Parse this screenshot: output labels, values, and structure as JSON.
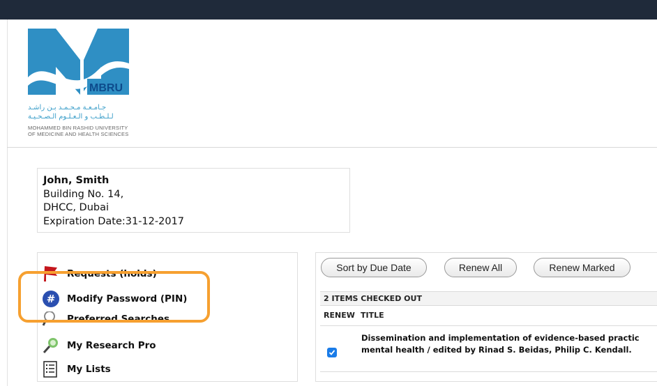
{
  "brand": {
    "logo_text": "MBRU",
    "arabic_line1": "جـامـعـة مـحـمـد بـن راشـد",
    "arabic_line2": "لـلـطـب و الـعـلـوم الـصـحـيـة",
    "english_line1": "MOHAMMED BIN RASHID UNIVERSITY",
    "english_line2": "OF MEDICINE AND HEALTH SCIENCES",
    "colors": {
      "primary_blue": "#2f8fc4",
      "dark_blue": "#0d4b8c",
      "highlight": "#f6a030"
    }
  },
  "patron": {
    "name": "John, Smith",
    "address1": "Building No. 14,",
    "address2": "DHCC, Dubai",
    "expiration": "Expiration Date:31-12-2017"
  },
  "menu": {
    "items": [
      {
        "label": "Requests (holds)",
        "icon": "flag-icon"
      },
      {
        "label": "Modify Password (PIN)",
        "icon": "hash-icon"
      },
      {
        "label": "Preferred Searches",
        "icon": "magnifier-icon"
      },
      {
        "label": "My Research Pro",
        "icon": "research-icon"
      },
      {
        "label": "My Lists",
        "icon": "list-icon"
      }
    ]
  },
  "checkout": {
    "buttons": {
      "sort": "Sort by Due Date",
      "renew_all": "Renew All",
      "renew_marked": "Renew Marked"
    },
    "summary": "2 ITEMS CHECKED OUT",
    "columns": {
      "renew": "RENEW",
      "title": "TITLE"
    },
    "rows": [
      {
        "title_line1": "Dissemination and implementation of evidence-based practic",
        "title_line2": "mental health / edited by Rinad S. Beidas, Philip C. Kendall.",
        "renew_checked": true
      }
    ]
  }
}
